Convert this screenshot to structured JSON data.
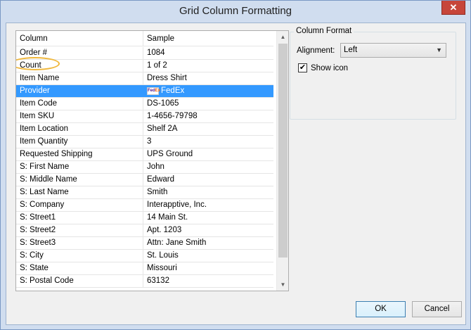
{
  "window": {
    "title": "Grid Column Formatting",
    "close_glyph": "✕"
  },
  "grid": {
    "headers": [
      "Column",
      "Sample"
    ],
    "rows": [
      {
        "column": "Order #",
        "sample": "1084"
      },
      {
        "column": "Count",
        "sample": "1 of 2"
      },
      {
        "column": "Item Name",
        "sample": "Dress Shirt"
      },
      {
        "column": "Provider",
        "sample": "FedEx",
        "selected": true,
        "sample_icon": "fedex-logo-icon"
      },
      {
        "column": "Item Code",
        "sample": "DS-1065"
      },
      {
        "column": "Item SKU",
        "sample": "1-4656-79798"
      },
      {
        "column": "Item Location",
        "sample": "Shelf 2A"
      },
      {
        "column": "Item Quantity",
        "sample": "3"
      },
      {
        "column": "Requested Shipping",
        "sample": "UPS Ground"
      },
      {
        "column": "S: First Name",
        "sample": "John"
      },
      {
        "column": "S: Middle Name",
        "sample": "Edward"
      },
      {
        "column": "S: Last Name",
        "sample": "Smith"
      },
      {
        "column": "S: Company",
        "sample": "Interapptive, Inc."
      },
      {
        "column": "S: Street1",
        "sample": "14 Main St."
      },
      {
        "column": "S: Street2",
        "sample": "Apt. 1203"
      },
      {
        "column": "S: Street3",
        "sample": "Attn: Jane Smith"
      },
      {
        "column": "S: City",
        "sample": "St. Louis"
      },
      {
        "column": "S: State",
        "sample": "Missouri"
      },
      {
        "column": "S: Postal Code",
        "sample": "63132"
      }
    ]
  },
  "column_format": {
    "title": "Column Format",
    "alignment_label": "Alignment:",
    "alignment_value": "Left",
    "show_icon_label": "Show icon",
    "show_icon_checked": true
  },
  "buttons": {
    "ok": "OK",
    "cancel": "Cancel"
  },
  "colors": {
    "selection": "#3399ff",
    "highlight_ring": "#f0b73b",
    "close_button": "#c7463a"
  }
}
